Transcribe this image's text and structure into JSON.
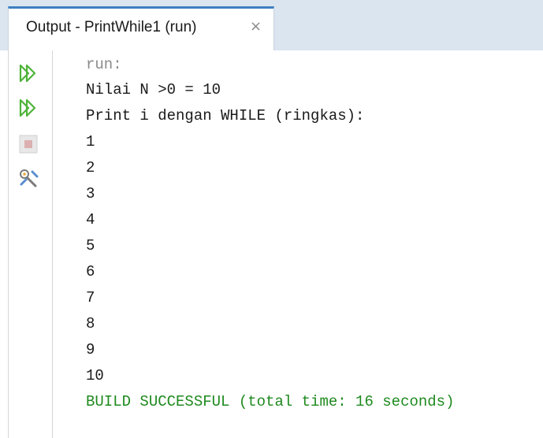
{
  "tab": {
    "title": "Output - PrintWhile1 (run)",
    "close": "×"
  },
  "toolbar": {
    "icons": [
      "rerun-icon",
      "rerun-with-options-icon",
      "stop-icon",
      "settings-icon"
    ]
  },
  "console": {
    "run_label": "run:",
    "lines": [
      "Nilai N >0 = 10",
      "Print i dengan WHILE (ringkas):",
      "1",
      "2",
      "3",
      "4",
      "5",
      "6",
      "7",
      "8",
      "9",
      "10"
    ],
    "build_status": "BUILD SUCCESSFUL (total time: 16 seconds)"
  },
  "colors": {
    "accent": "#3d7fc1",
    "success": "#1f8a1f",
    "muted": "#8a8a8a",
    "tab_bar": "#dae5f0",
    "run_icon": "#4fb33a"
  }
}
